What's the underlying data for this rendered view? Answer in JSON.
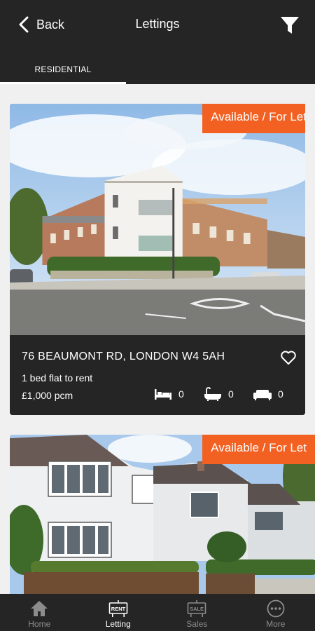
{
  "header": {
    "back_label": "Back",
    "title": "Lettings",
    "tab_label": "RESIDENTIAL"
  },
  "listings": [
    {
      "badge": "Available / For Let",
      "address": "76 BEAUMONT RD, LONDON W4 5AH",
      "description": "1 bed flat to rent",
      "price": "£1,000 pcm",
      "bedrooms": "0",
      "bathrooms": "0",
      "receptions": "0"
    },
    {
      "badge": "Available / For Let"
    }
  ],
  "bottom_nav": {
    "items": [
      {
        "label": "Home",
        "icon": "home-icon"
      },
      {
        "label": "Letting",
        "icon": "rent-sign-icon",
        "sign": "RENT"
      },
      {
        "label": "Sales",
        "icon": "sale-sign-icon",
        "sign": "SALE"
      },
      {
        "label": "More",
        "icon": "more-icon"
      }
    ],
    "active": "Letting"
  },
  "colors": {
    "accent": "#f26122",
    "header_bg": "#252525",
    "page_bg": "#f0f0f0"
  }
}
